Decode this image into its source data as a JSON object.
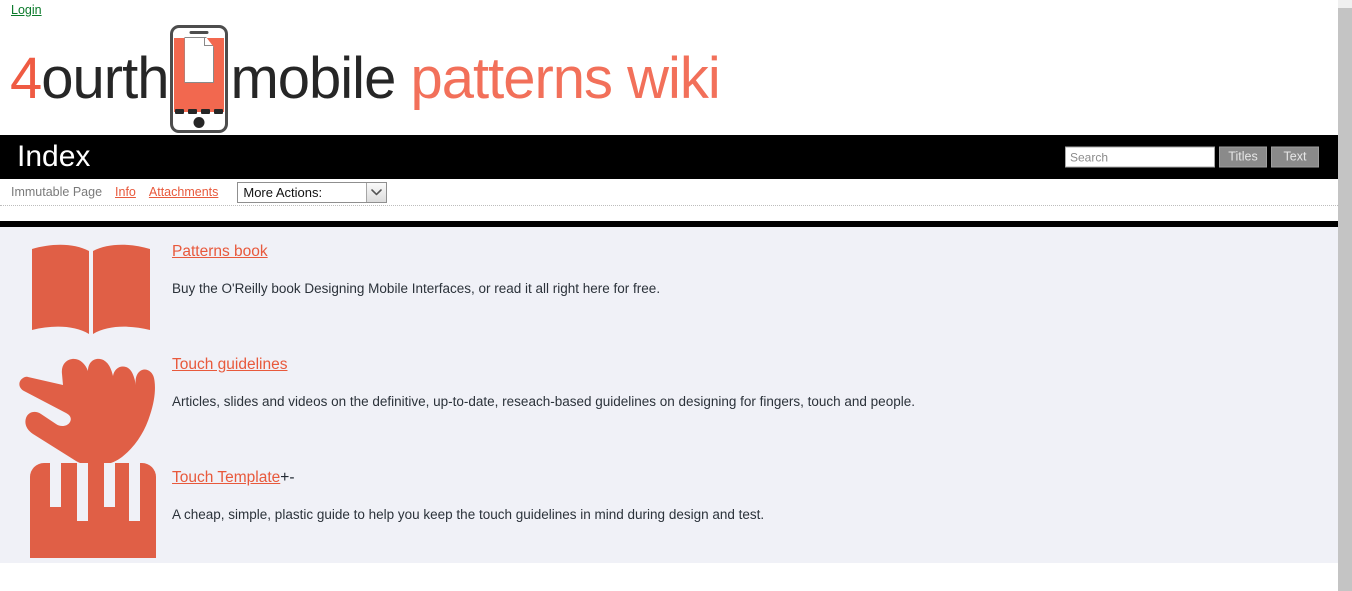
{
  "top": {
    "login_label": "Login"
  },
  "logo": {
    "part_4": "4",
    "part_ourth": "ourth",
    "part_mobile": "mobile",
    "part_patterns_wiki": "patterns wiki",
    "phone_icon": "mobile-phone-icon"
  },
  "titlebar": {
    "title": "Index",
    "search_placeholder": "Search",
    "search_value": "",
    "btn_titles": "Titles",
    "btn_text": "Text"
  },
  "actionbar": {
    "immutable_label": "Immutable Page",
    "info_label": "Info",
    "attachments_label": "Attachments",
    "more_actions_selected": "More Actions:"
  },
  "colors": {
    "accent": "#e8593c",
    "logo_coral": "#f2705a",
    "link_green": "#0a7a2a",
    "content_bg": "#f0f1f7",
    "titlebar_bg": "#000000"
  },
  "content": {
    "entries": [
      {
        "icon": "open-book-icon",
        "title": "Patterns book",
        "suffix": "",
        "description": "Buy the O'Reilly book Designing Mobile Interfaces, or read it all right here for free."
      },
      {
        "icon": "pointing-hand-icon",
        "title": "Touch guidelines",
        "suffix": "",
        "description": "Articles, slides and videos on the definitive, up-to-date, reseach-based guidelines on designing for fingers, touch and people."
      },
      {
        "icon": "touch-template-comb-icon",
        "title": "Touch Template",
        "suffix": "+-",
        "description": "A cheap, simple, plastic guide to help you keep the touch guidelines in mind during design and test."
      }
    ]
  }
}
